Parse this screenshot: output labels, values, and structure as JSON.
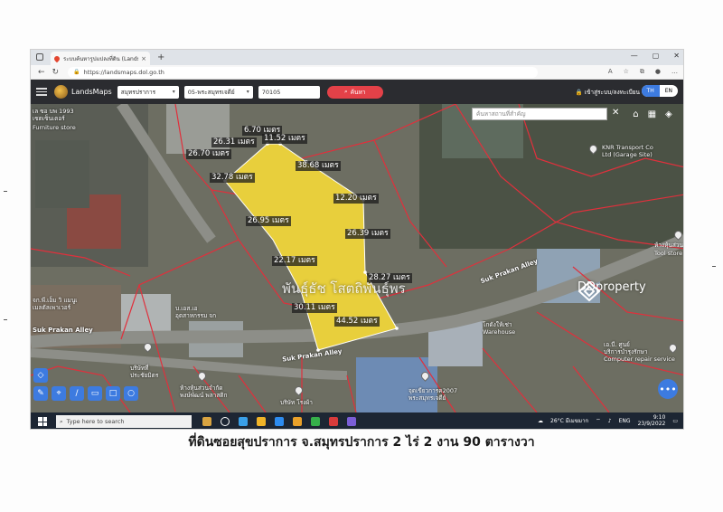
{
  "browser": {
    "tab_title": "ระบบค้นหารูปแปลงที่ดิน (LandsMap...",
    "tab_close": "×",
    "new_tab": "+",
    "url": "https://landsmaps.dol.go.th",
    "window_controls": [
      "—",
      "▢",
      "✕"
    ]
  },
  "toolbar": {
    "brand": "LandsMaps",
    "province": "สมุทรปราการ",
    "district": "05-พระสมุทรเจดีย์",
    "parcel_code": "70105",
    "search_label": "ค้นหา",
    "login_label": "เข้าสู่ระบบ/ลงทะเบียน",
    "lang_th": "TH",
    "lang_en": "EN"
  },
  "map": {
    "search_placeholder": "ค้นหาสถานที่สำคัญ",
    "measurements": [
      "6.70 เมตร",
      "11.52 เมตร",
      "26.31 เมตร",
      "26.70 เมตร",
      "38.68 เมตร",
      "32.78 เมตร",
      "12.20 เมตร",
      "26.95 เมตร",
      "26.39 เมตร",
      "22.17 เมตร",
      "28.27 เมตร",
      "30.11 เมตร",
      "44.52 เมตร"
    ],
    "places": {
      "top_left": "เล ซอ บพ 1993",
      "top_left2": "เซตเซ็นเตอร์",
      "furniture": "Furniture store",
      "knr1": "KNR Transport Co",
      "knr2": "Ltd (Garage Site)",
      "tool1": "ห้างหุ้นส่วน",
      "tool2": "Tool store",
      "alley_left1": "จก.พี.เอ็ม วิ แมนูเ",
      "alley_left2": "เมลตัลเพาเวอร์",
      "center_left1": "บ.เอส.เอ",
      "center_left2": "อุตสาหกรรม จก",
      "warehouse1": "โกดังให้เช่า",
      "warehouse2": "Warehouse",
      "computer1": "เอ.บี. ศูนย์",
      "computer2": "บริการบำรุงรักษา",
      "computer3": "Computer repair service",
      "bottom_left1": "บริษัทที่",
      "bottom_left2": "ประชัยมิตร",
      "bottom_mid1": "ห้างหุ้นส่วนจำกัด",
      "bottom_mid2": "พงษ์พัฒน์ พลาสติก",
      "bottom_mid3": "บริษัท โรงผ้า",
      "bottom_right1": "จุดเขียวการค2007",
      "bottom_right2": "พระสมุทรเจดีย์"
    },
    "roads": {
      "alley_right": "Suk Prakan Alley",
      "alley_left": "Suk Prakan Alley",
      "alley_bottom": "Suk Prakan Alley"
    },
    "watermark": "พันธุ์ธัช โสตถิพันธุ์พร",
    "dd_brand": "DDproperty",
    "fab_label": "•••"
  },
  "taskbar": {
    "search_placeholder": "Type here to search",
    "weather": "26°C มีเมฆมาก",
    "lang": "ENG",
    "time": "9:10",
    "date": "23/9/2022"
  },
  "caption": "ที่ดินซอยสุขปราการ จ.สมุทรปราการ  2 ไร่ 2 งาน 90 ตารางวา",
  "colors": {
    "parcel_fill": "#e8cf3c",
    "boundary": "#e0303c",
    "search_button": "#e34148",
    "accent": "#3d7be0"
  }
}
